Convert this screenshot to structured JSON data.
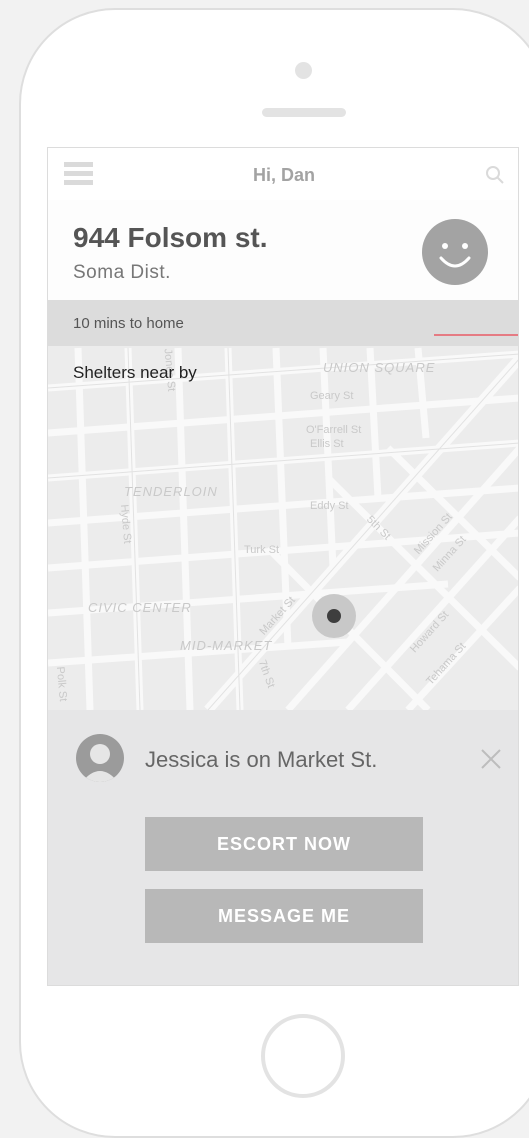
{
  "header": {
    "greeting": "Hi, Dan",
    "menu_icon": "hamburger-menu-icon",
    "search_icon": "search-icon"
  },
  "location": {
    "address": "944 Folsom st.",
    "district": "Soma Dist.",
    "status_icon": "smiley-face-icon"
  },
  "eta": {
    "text": "10 mins to home"
  },
  "shelters": {
    "label": "Shelters near by"
  },
  "map": {
    "labels": [
      "UNION SQUARE",
      "Geary St",
      "O'Farrell St",
      "Ellis St",
      "Eddy St",
      "TENDERLOIN",
      "Turk St",
      "CIVIC CENTER",
      "MID-MARKET",
      "Market St",
      "Mission St",
      "Howard St",
      "Tehama St",
      "Minna St",
      "5th St",
      "7th St",
      "Hyde St",
      "Polk St",
      "Jones St"
    ]
  },
  "card": {
    "notice": "Jessica is on Market St.",
    "escort_label": "ESCORT NOW",
    "message_label": "MESSAGE ME"
  },
  "colors": {
    "accent": "#e57b83",
    "button_bg": "#b8b8b8",
    "card_bg": "#e6e6e7",
    "map_bg": "#ececec"
  }
}
